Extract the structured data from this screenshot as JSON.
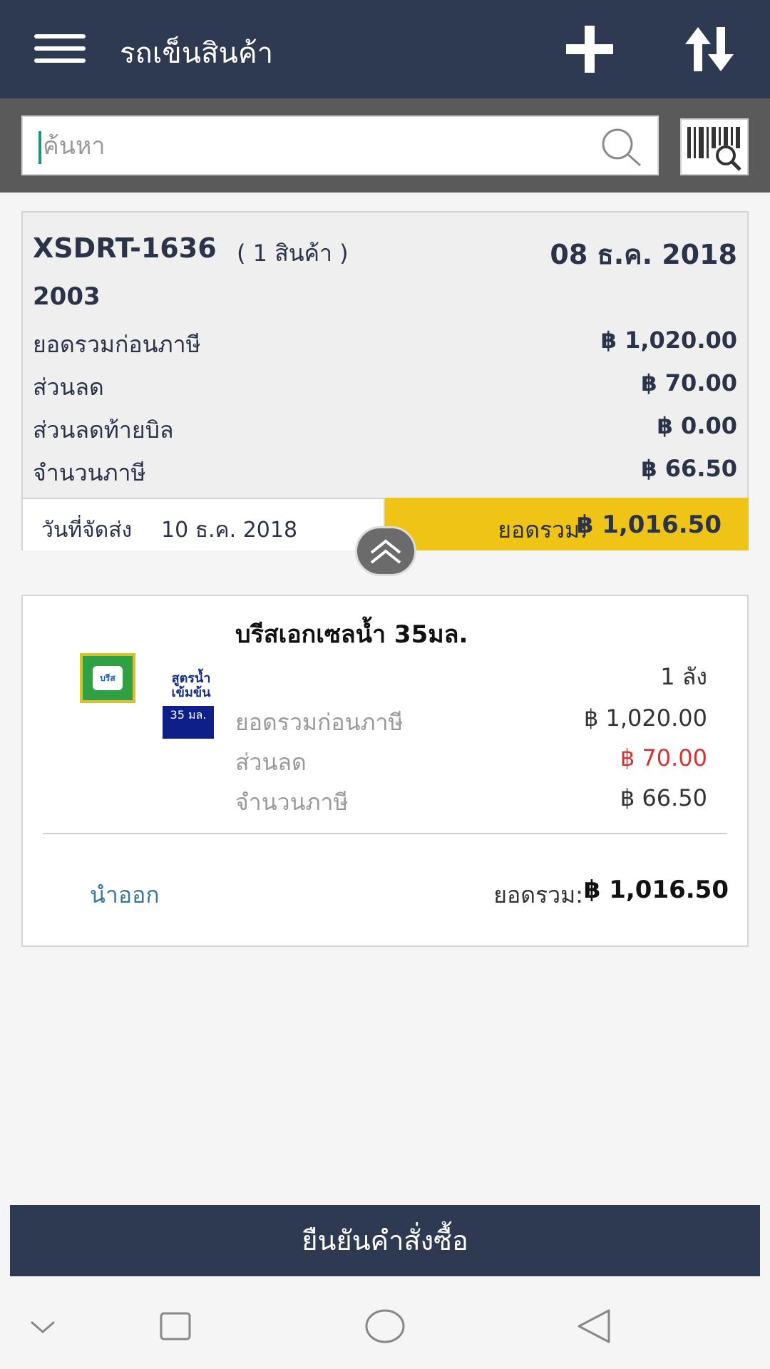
{
  "header": {
    "title": "รถเข็นสินค้า",
    "menu_icon": "hamburger-menu-icon",
    "add_icon": "plus-icon",
    "sort_icon": "sort-arrows-icon"
  },
  "search": {
    "placeholder": "ค้นหา",
    "value": "",
    "search_icon": "search-icon",
    "barcode_icon": "barcode-scan-icon"
  },
  "summary": {
    "order_id": "XSDRT-1636",
    "item_count": "( 1 สินค้า )",
    "date": "08 ธ.ค. 2018",
    "sub_id": "2003",
    "rows": [
      {
        "label": "ยอดรวมก่อนภาษี",
        "value": "฿ 1,020.00"
      },
      {
        "label": "ส่วนลด",
        "value": "฿ 70.00"
      },
      {
        "label": "ส่วนลดท้ายบิล",
        "value": "฿ 0.00"
      },
      {
        "label": "จำนวนภาษี",
        "value": "฿ 66.50"
      }
    ],
    "delivery_label": "วันที่จัดส่ง",
    "delivery_date": "10 ธ.ค. 2018",
    "total_label": "ยอดรวม:",
    "total_value": "฿ 1,016.50",
    "collapse_icon": "double-chevron-up-icon"
  },
  "item": {
    "name": "บรีสเอกเซลน้ำ 35มล.",
    "brand_text": "บรีส",
    "pkg_text": "สูตรน้ำ เข้มข้น",
    "pkg_badge": "35 มล.",
    "quantity": "1 ลัง",
    "rows": [
      {
        "label": "ยอดรวมก่อนภาษี",
        "value": "฿ 1,020.00"
      },
      {
        "label": "ส่วนลด",
        "value": "฿ 70.00"
      },
      {
        "label": "จำนวนภาษี",
        "value": "฿ 66.50"
      }
    ],
    "remove_label": "นำออก",
    "total_label": "ยอดรวม:",
    "total_value": "฿ 1,016.50"
  },
  "confirm": {
    "label": "ยืนยันคำสั่งซื้อ"
  },
  "navbar": {
    "icons": [
      "chevron-down-icon",
      "recent-apps-icon",
      "home-icon",
      "back-icon"
    ]
  },
  "colors": {
    "header_bg": "#2d3a52",
    "total_bar": "#f0c417",
    "discount_red": "#d63232",
    "link_blue": "#3a78a0"
  }
}
